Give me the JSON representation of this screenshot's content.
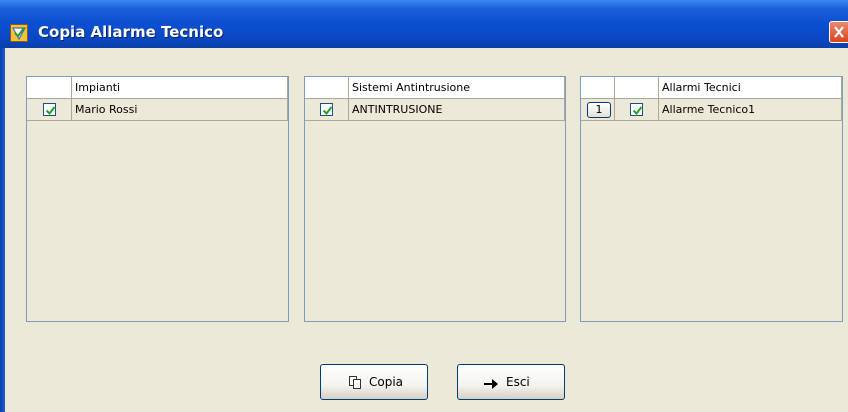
{
  "window": {
    "title": "Copia Allarme Tecnico",
    "icon": "app-icon",
    "close_icon": "close-icon"
  },
  "panels": [
    {
      "header": "Impianti",
      "rows": [
        {
          "checked": true,
          "label": "Mario Rossi"
        }
      ]
    },
    {
      "header": "Sistemi Antintrusione",
      "rows": [
        {
          "checked": true,
          "label": "ANTINTRUSIONE"
        }
      ]
    },
    {
      "header": "Allarmi Tecnici",
      "rows": [
        {
          "number": "1",
          "checked": true,
          "label": "Allarme Tecnico1"
        }
      ]
    }
  ],
  "buttons": {
    "copy": {
      "label": "Copia",
      "icon": "copy-icon"
    },
    "exit": {
      "label": "Esci",
      "icon": "arrow-right-icon"
    }
  },
  "colors": {
    "titlebar": "#0b4fd0",
    "background": "#ece9d8",
    "check": "#21a121",
    "close": "#d9451f"
  }
}
